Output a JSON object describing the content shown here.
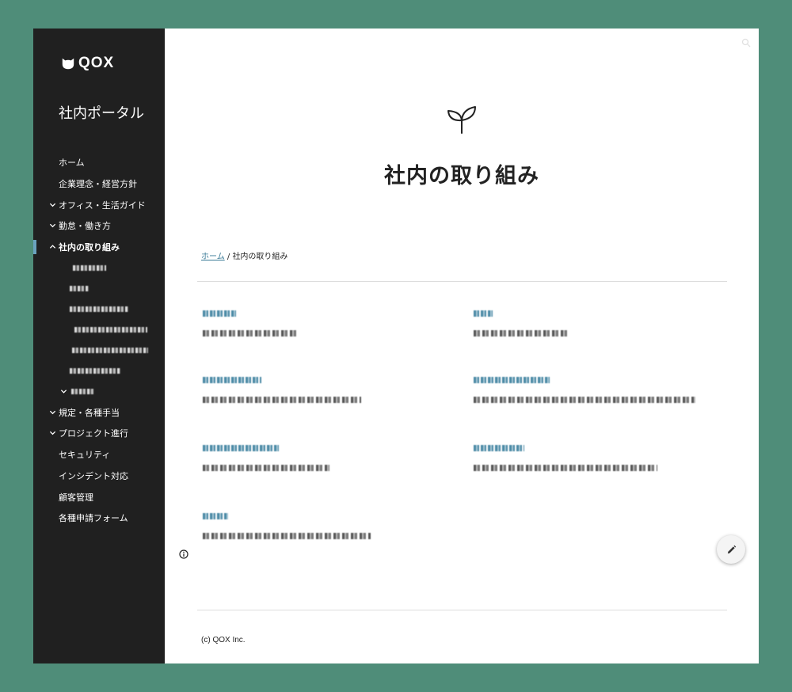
{
  "brand": {
    "name": "QOX",
    "logo_icon": "cat-icon"
  },
  "sidebar": {
    "title": "社内ポータル",
    "items": [
      {
        "label": "ホーム",
        "expandable": false
      },
      {
        "label": "企業理念・経営方針",
        "expandable": false
      },
      {
        "label": "オフィス・生活ガイド",
        "expandable": true,
        "state": "collapsed"
      },
      {
        "label": "勤怠・働き方",
        "expandable": true,
        "state": "collapsed"
      },
      {
        "label": "社内の取り組み",
        "expandable": true,
        "state": "expanded",
        "active": true
      },
      {
        "label": "規定・各種手当",
        "expandable": true,
        "state": "collapsed"
      },
      {
        "label": "プロジェクト進行",
        "expandable": true,
        "state": "collapsed"
      },
      {
        "label": "セキュリティ",
        "expandable": false
      },
      {
        "label": "インシデント対応",
        "expandable": false
      },
      {
        "label": "顧客管理",
        "expandable": false
      },
      {
        "label": "各種申請フォーム",
        "expandable": false
      }
    ]
  },
  "main": {
    "page_icon": "sprout-icon",
    "title": "社内の取り組み",
    "breadcrumb": {
      "home": "ホーム",
      "separator": " / ",
      "current": "社内の取り組み"
    },
    "footer": "(c) QOX Inc."
  },
  "colors": {
    "accent": "#3a7b97",
    "sidebar_bg": "#202020",
    "backdrop": "#4f8d79",
    "active_marker": "#6aa2bd"
  }
}
